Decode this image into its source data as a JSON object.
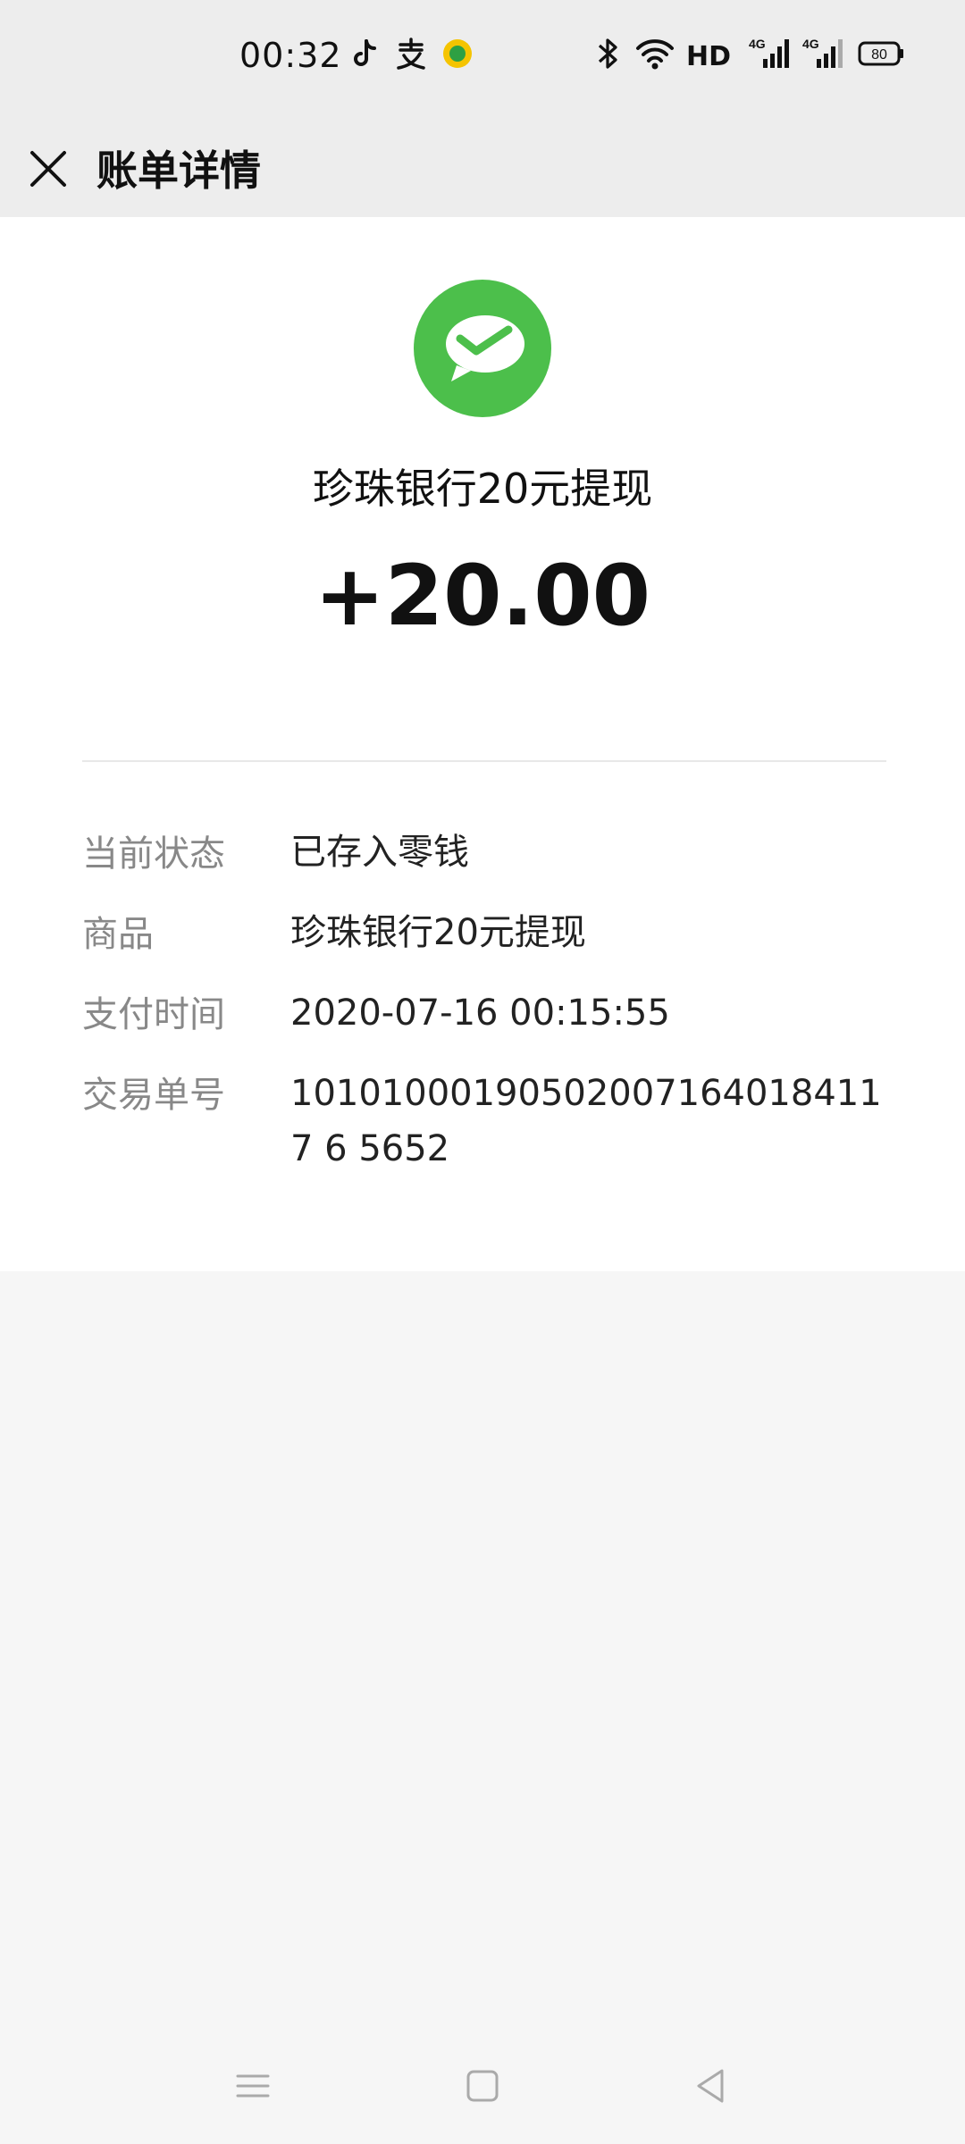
{
  "status_bar": {
    "time": "00:32",
    "battery": "80",
    "network_labels": [
      "HD",
      "4G",
      "4G"
    ],
    "icons": [
      "tiktok-icon",
      "alipay-icon",
      "app-badge-icon",
      "bluetooth-icon",
      "wifi-icon",
      "hd-icon",
      "signal-icon",
      "signal-icon",
      "battery-icon"
    ]
  },
  "header": {
    "title": "账单详情",
    "close_icon": "close-icon"
  },
  "transaction": {
    "merchant": "珍珠银行20元提现",
    "amount": "+20.00",
    "logo_icon": "wechat-pay-icon",
    "details": [
      {
        "label": "当前状态",
        "value": "已存入零钱"
      },
      {
        "label": "商品",
        "value": "珍珠银行20元提现"
      },
      {
        "label": "支付时间",
        "value": "2020-07-16 00:15:55"
      },
      {
        "label": "交易单号",
        "value": "101010001905020071640184117 6 5652"
      }
    ]
  },
  "bottom_nav": {
    "icons": [
      "menu-icon",
      "home-icon",
      "back-icon"
    ]
  },
  "colors": {
    "brand_green": "#4cbf4b",
    "background": "#f6f6f6",
    "header_bg": "#ededed"
  }
}
